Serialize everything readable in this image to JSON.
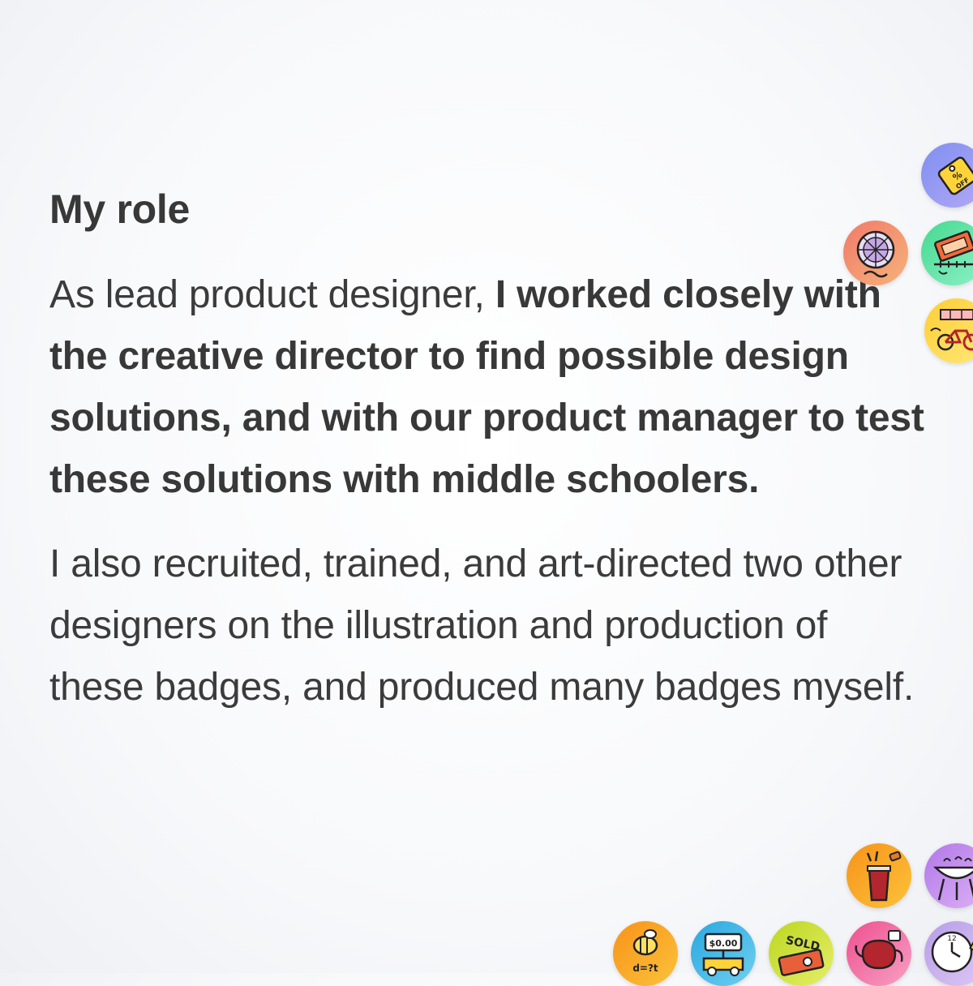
{
  "heading": "My role",
  "p1": {
    "plain": "As lead product designer, ",
    "bold": "I worked closely with the creative director to find possible design solutions, and with our product manager to test these solutions with middle schoolers."
  },
  "p2": "I also recruited, trained, and art-directed two other designers on the illustration and production of these badges, and produced many badges myself.",
  "badges": [
    {
      "name": "discount-tag-badge",
      "label": "OFF",
      "symbol": "%",
      "color": "#8fa3f0"
    },
    {
      "name": "spinner-wheel-badge",
      "color": "#f49a6a"
    },
    {
      "name": "ticket-badge",
      "color": "#5fe0a0"
    },
    {
      "name": "bicycle-badge",
      "color": "#ffd84a"
    },
    {
      "name": "drink-cup-badge",
      "color": "#f7a21c"
    },
    {
      "name": "grill-badge",
      "color": "#c38ef0"
    },
    {
      "name": "bee-badge",
      "label": "d=?t",
      "color": "#f7a21c"
    },
    {
      "name": "price-sign-badge",
      "label": "$0.00",
      "color": "#3fb6e6"
    },
    {
      "name": "sold-badge",
      "label": "SOLD",
      "color": "#c8dd2a"
    },
    {
      "name": "teapot-badge",
      "color": "#f06aa0"
    },
    {
      "name": "clock-badge",
      "label": "12",
      "color": "#c9a8ea"
    }
  ]
}
